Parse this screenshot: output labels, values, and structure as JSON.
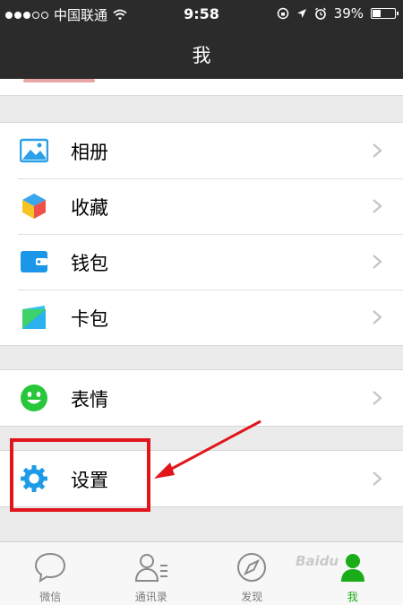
{
  "status_bar": {
    "carrier": "中国联通",
    "time": "9:58",
    "battery": "39%",
    "battery_level": 0.39
  },
  "nav": {
    "title": "我"
  },
  "groups": [
    {
      "items": [
        {
          "label": "相册",
          "icon": "photo-album-icon"
        },
        {
          "label": "收藏",
          "icon": "favorites-cube-icon"
        },
        {
          "label": "钱包",
          "icon": "wallet-icon"
        },
        {
          "label": "卡包",
          "icon": "card-pack-icon"
        }
      ]
    },
    {
      "items": [
        {
          "label": "表情",
          "icon": "smiley-icon"
        }
      ]
    },
    {
      "items": [
        {
          "label": "设置",
          "icon": "gear-icon"
        }
      ]
    }
  ],
  "tabs": [
    {
      "label": "微信",
      "icon": "chat-bubble-icon"
    },
    {
      "label": "通讯录",
      "icon": "contacts-icon"
    },
    {
      "label": "发现",
      "icon": "compass-icon"
    },
    {
      "label": "我",
      "icon": "person-icon",
      "active": true
    }
  ],
  "watermark": "Baidu",
  "colors": {
    "accent_green": "#1aad19",
    "annotation_red": "#e0161c",
    "bar_dark": "#2b2b2b"
  }
}
